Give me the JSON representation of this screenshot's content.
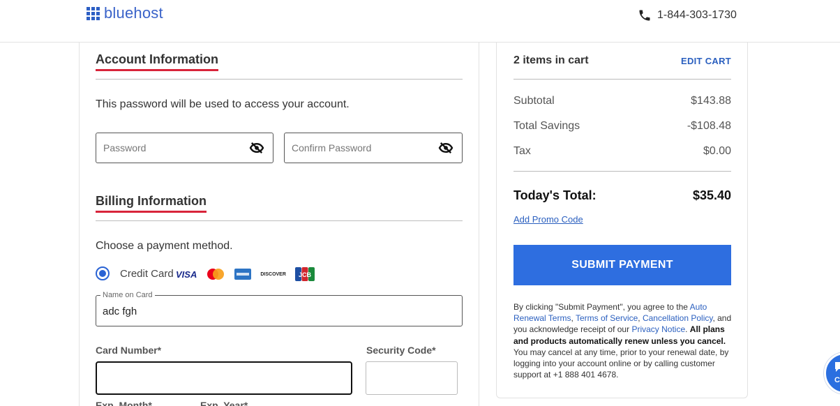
{
  "header": {
    "logo_text": "bluehost",
    "phone": "1-844-303-1730"
  },
  "account": {
    "title": "Account Information",
    "description": "This password will be used to access your account.",
    "password_placeholder": "Password",
    "confirm_placeholder": "Confirm Password"
  },
  "billing": {
    "title": "Billing Information",
    "choose_method": "Choose a payment method.",
    "credit_card_label": "Credit Card",
    "card_brands": [
      "VISA",
      "Mastercard",
      "AMEX",
      "DISCOVER",
      "JCB"
    ],
    "name_on_card_label": "Name on Card",
    "name_on_card_value": "adc fgh",
    "card_number_label": "Card Number*",
    "security_code_label": "Security Code*",
    "exp_month_label": "Exp. Month*",
    "exp_year_label": "Exp. Year*"
  },
  "cart": {
    "items_label": "2 items in cart",
    "edit_cart": "EDIT CART",
    "subtotal_label": "Subtotal",
    "subtotal_value": "$143.88",
    "savings_label": "Total Savings",
    "savings_value": "-$108.48",
    "tax_label": "Tax",
    "tax_value": "$0.00",
    "total_label": "Today's Total:",
    "total_value": "$35.40",
    "promo_link": "Add Promo Code",
    "submit_label": "SUBMIT PAYMENT"
  },
  "terms": {
    "t1": "By clicking \"Submit Payment\", you agree to the ",
    "l1": "Auto Renewal Terms",
    "t2": ", ",
    "l2": "Terms of Service",
    "t3": ", ",
    "l3": "Cancellation Policy",
    "t4": ", and you acknowledge receipt of our ",
    "l4": "Privacy Notice",
    "t5": ". ",
    "bold": "All plans and products automatically renew unless you cancel.",
    "t6": " You may cancel at any time, prior to your renewal date, by logging into your account online or by calling customer support at +1 888 401 4678."
  },
  "chat": {
    "label": "Cl"
  },
  "colors": {
    "brand_blue": "#2e6ee0",
    "title_underline": "#d8243a",
    "link_blue": "#2a5fbf"
  }
}
